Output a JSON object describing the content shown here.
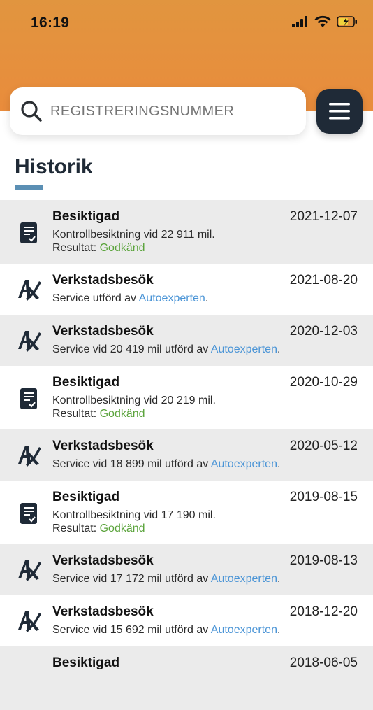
{
  "status_bar": {
    "time": "16:19"
  },
  "search": {
    "placeholder": "REGISTRERINGSNUMMER"
  },
  "page": {
    "title": "Historik"
  },
  "history": [
    {
      "type": "inspection",
      "title": "Besiktigad",
      "date": "2021-12-07",
      "line1": "Kontrollbesiktning vid 22 911 mil.",
      "result_label": "Resultat: ",
      "result_value": "Godkänd"
    },
    {
      "type": "workshop",
      "title": "Verkstadsbesök",
      "date": "2021-08-20",
      "line1_prefix": "Service utförd av ",
      "workshop": "Autoexperten",
      "line1_suffix": "."
    },
    {
      "type": "workshop",
      "title": "Verkstadsbesök",
      "date": "2020-12-03",
      "line1_prefix": "Service vid 20 419 mil utförd av ",
      "workshop": "Autoexperten",
      "line1_suffix": "."
    },
    {
      "type": "inspection",
      "title": "Besiktigad",
      "date": "2020-10-29",
      "line1": "Kontrollbesiktning vid 20 219 mil.",
      "result_label": "Resultat: ",
      "result_value": "Godkänd"
    },
    {
      "type": "workshop",
      "title": "Verkstadsbesök",
      "date": "2020-05-12",
      "line1_prefix": "Service vid 18 899 mil utförd av ",
      "workshop": "Autoexperten",
      "line1_suffix": "."
    },
    {
      "type": "inspection",
      "title": "Besiktigad",
      "date": "2019-08-15",
      "line1": "Kontrollbesiktning vid 17 190 mil.",
      "result_label": "Resultat: ",
      "result_value": "Godkänd"
    },
    {
      "type": "workshop",
      "title": "Verkstadsbesök",
      "date": "2019-08-13",
      "line1_prefix": "Service vid 17 172 mil utförd av ",
      "workshop": "Autoexperten",
      "line1_suffix": "."
    },
    {
      "type": "workshop",
      "title": "Verkstadsbesök",
      "date": "2018-12-20",
      "line1_prefix": "Service vid 15 692 mil utförd av ",
      "workshop": "Autoexperten",
      "line1_suffix": "."
    },
    {
      "type": "inspection",
      "title": "Besiktigad",
      "date": "2018-06-05"
    }
  ],
  "colors": {
    "header": "#e98c3c",
    "accent_green": "#5aa33b",
    "link_blue": "#4a94d6",
    "menu_button": "#1f2a37",
    "underline": "#5b8fb4"
  }
}
